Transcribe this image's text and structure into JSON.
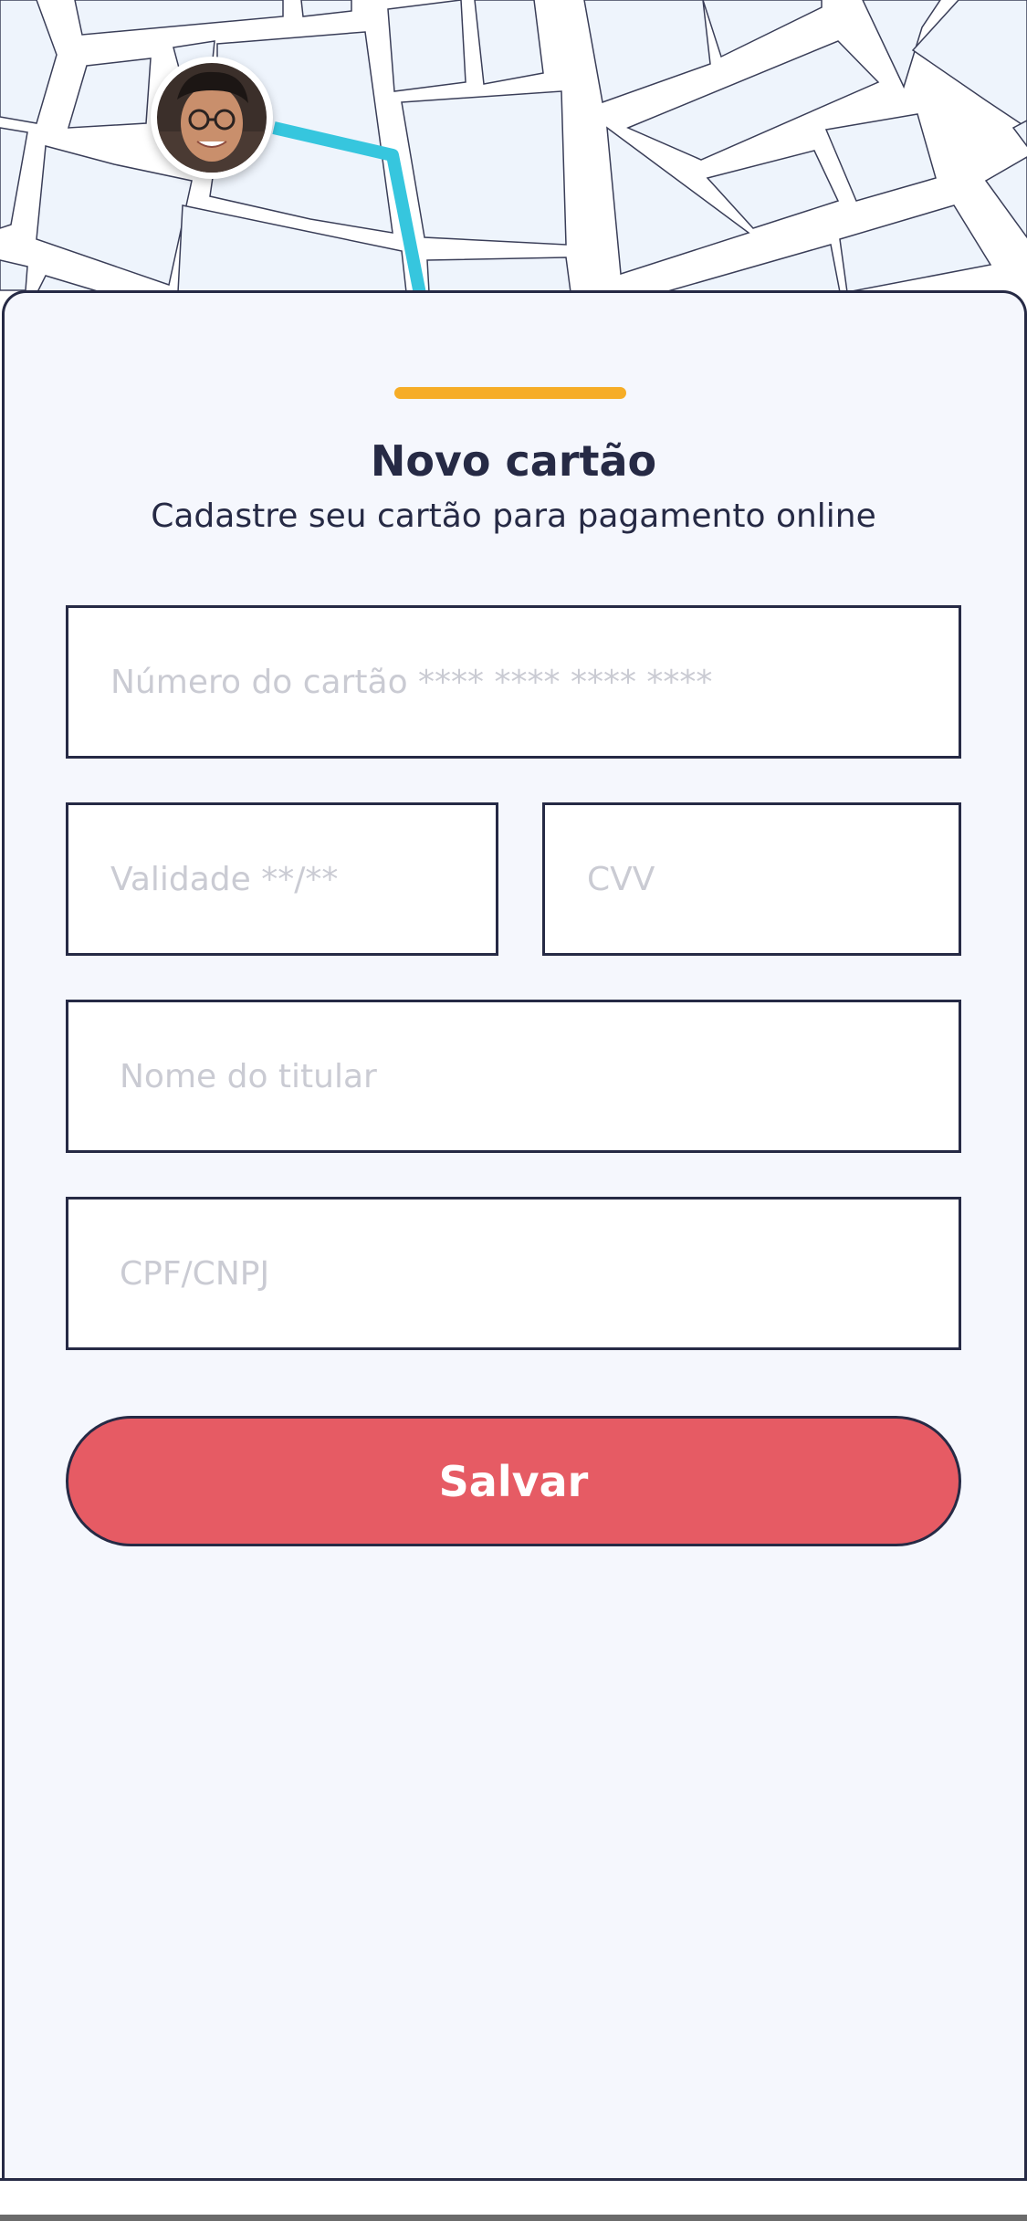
{
  "form": {
    "title": "Novo cartão",
    "subtitle": "Cadastre seu cartão para pagamento online",
    "fields": {
      "card_number_placeholder": "Número do cartão **** **** **** ****",
      "validity_placeholder": "Validade **/**",
      "cvv_placeholder": "CVV",
      "holder_name_placeholder": "Nome do titular",
      "document_placeholder": "CPF/CNPJ"
    },
    "save_label": "Salvar"
  },
  "colors": {
    "accent_handle": "#f6ad27",
    "save_button": "#e65b64",
    "route_line": "#36c6de",
    "map_block": "#eef4fc",
    "text_dark": "#262a45"
  },
  "icons": {
    "avatar": "user-avatar-photo"
  }
}
